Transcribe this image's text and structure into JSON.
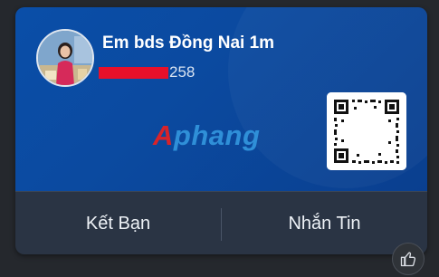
{
  "card": {
    "name": "Em bds Đồng Nai 1m",
    "phone_suffix": "258",
    "watermark_a": "A",
    "watermark_rest": "phang"
  },
  "actions": {
    "add_friend_label": "Kết Bạn",
    "message_label": "Nhắn Tin"
  },
  "icons": {
    "avatar": "avatar-photo",
    "qr": "qr-code-icon",
    "like": "thumbs-up-icon"
  },
  "colors": {
    "card_blue": "#0b4aa0",
    "action_bar": "#2a3444",
    "redaction": "#e8102a",
    "page_bg": "#25282d"
  }
}
